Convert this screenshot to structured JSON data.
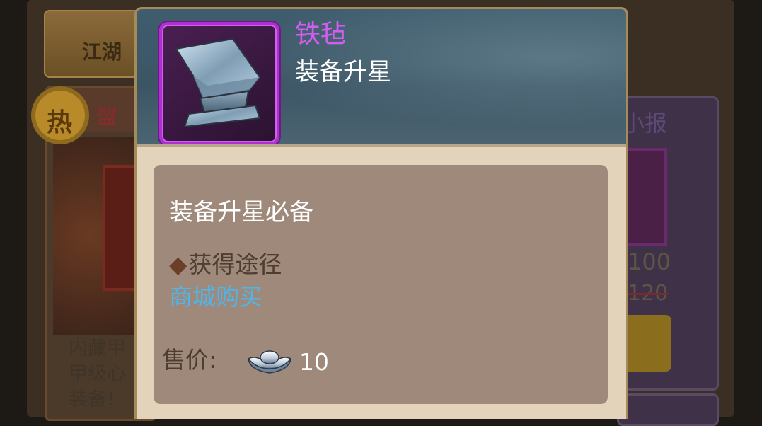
{
  "background": {
    "top_button_label": "江湖",
    "hot_badge": "热",
    "left_card_title": "盟",
    "left_card_text": [
      "内藏甲",
      "甲级心",
      "装备!"
    ],
    "right_card_title": "小报",
    "right_card_price": "100",
    "right_card_old_price": "120"
  },
  "popup": {
    "item_name": "铁毡",
    "item_type": "装备升星",
    "item_icon": "anvil-icon",
    "description": "装备升星必备",
    "source_heading": "获得途径",
    "source_link": "商城购买",
    "price_label": "售价:",
    "price_icon": "silver-ingot-icon",
    "price_value": "10"
  },
  "colors": {
    "item_name": "#d35cf2",
    "rarity_frame": "#b12ed4",
    "link": "#4fb6ec",
    "panel": "#9e897a"
  }
}
